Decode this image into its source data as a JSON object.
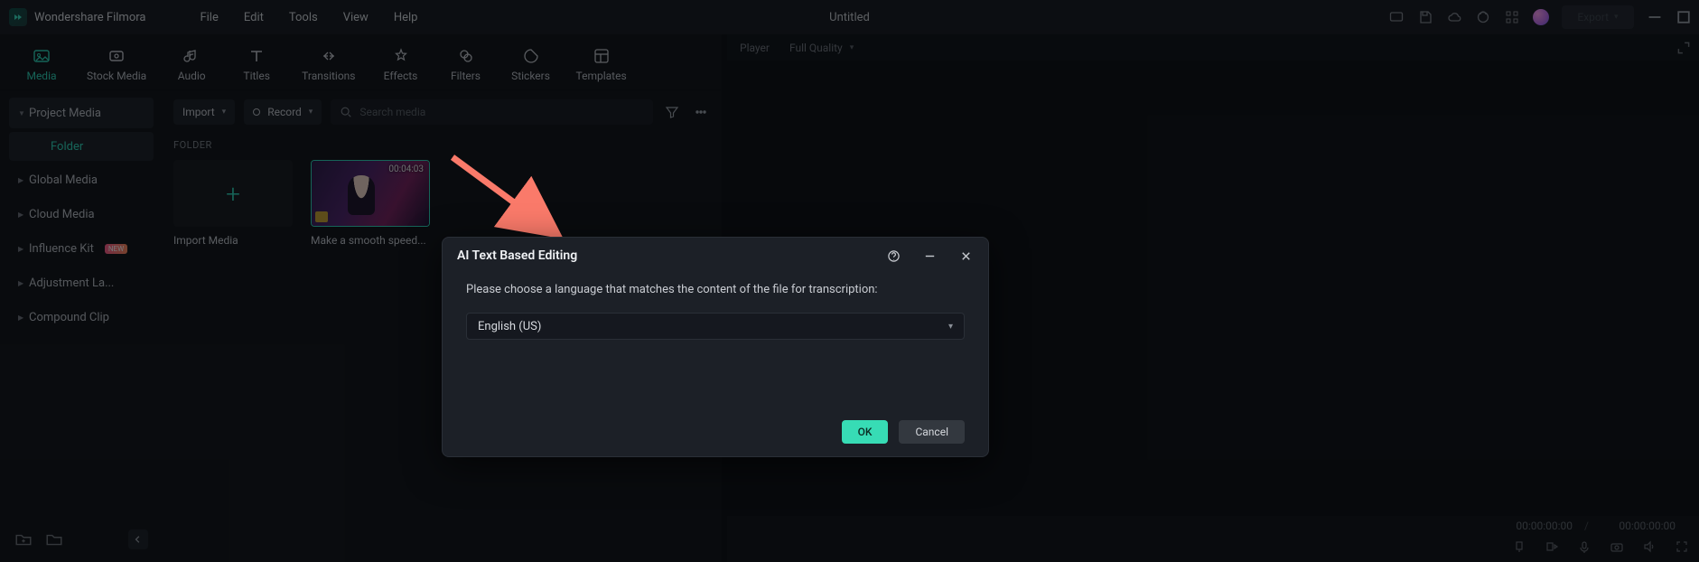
{
  "app": {
    "name": "Wondershare Filmora",
    "document_title": "Untitled",
    "export_label": "Export"
  },
  "menus": [
    "File",
    "Edit",
    "Tools",
    "View",
    "Help"
  ],
  "tooltabs": [
    "Media",
    "Stock Media",
    "Audio",
    "Titles",
    "Transitions",
    "Effects",
    "Filters",
    "Stickers",
    "Templates"
  ],
  "sidebar": {
    "items": [
      {
        "label": "Project Media",
        "active": true
      },
      {
        "label": "Global Media"
      },
      {
        "label": "Cloud Media"
      },
      {
        "label": "Influence Kit",
        "badge": "NEW"
      },
      {
        "label": "Adjustment La..."
      },
      {
        "label": "Compound Clip"
      }
    ],
    "sub_label": "Folder"
  },
  "content": {
    "import_btn": "Import",
    "record_btn": "Record",
    "search_placeholder": "Search media",
    "section_label": "FOLDER",
    "import_tile_label": "Import Media",
    "clip": {
      "duration": "00:04:03",
      "label": "Make a smooth speed..."
    }
  },
  "player": {
    "tab_label": "Player",
    "quality_label": "Full Quality",
    "timecode_current": "00:00:00:00",
    "timecode_total": "00:00:00:00",
    "timecode_sep": "/"
  },
  "dialog": {
    "title": "AI Text Based Editing",
    "message": "Please choose a language that matches the content of the file for transcription:",
    "selected_language": "English (US)",
    "ok_label": "OK",
    "cancel_label": "Cancel"
  }
}
